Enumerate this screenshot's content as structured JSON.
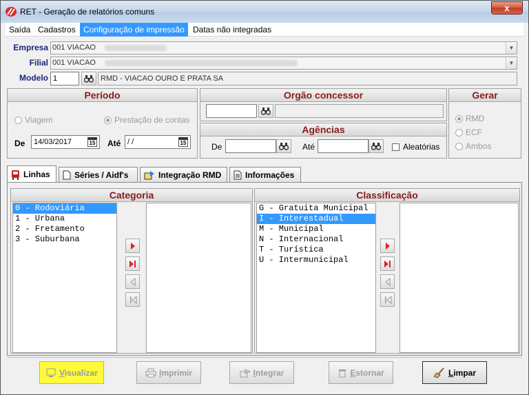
{
  "window": {
    "title": "RET - Geração de relatórios comuns",
    "close_label": "x"
  },
  "menu": [
    {
      "label": "Saída"
    },
    {
      "label": "Cadastros"
    },
    {
      "label": "Configuração de impressão"
    },
    {
      "label": "Datas não integradas"
    }
  ],
  "form": {
    "empresa_label": "Empresa",
    "empresa_value": "001 VIACAO",
    "filial_label": "Filial",
    "filial_value": "001 VIACAO",
    "modelo_label": "Modelo",
    "modelo_code": "1",
    "modelo_desc": "RMD - VIACAO OURO E PRATA SA"
  },
  "periodo": {
    "title": "Período",
    "radio_viagem": "Viagem",
    "radio_prestacao": "Prestação de contas",
    "de_label": "De",
    "de_value": "14/03/2017",
    "ate_label": "Até",
    "ate_value": " / /",
    "cal_label": "15"
  },
  "orgao": {
    "title": "Orgão concessor"
  },
  "agencias": {
    "title": "Agências",
    "de_label": "De",
    "ate_label": "Até",
    "aleatorias_label": "Aleatórias"
  },
  "gerar": {
    "title": "Gerar",
    "options": [
      {
        "label": "RMD"
      },
      {
        "label": "ECF"
      },
      {
        "label": "Ambos"
      }
    ]
  },
  "tabs": [
    {
      "label": "Linhas"
    },
    {
      "label": "Séries / Aidf's"
    },
    {
      "label": "Integração RMD"
    },
    {
      "label": "Informações"
    }
  ],
  "categoria": {
    "title": "Categoria",
    "items": [
      "0 - Rodoviária",
      "1 - Urbana",
      "2 - Fretamento",
      "3 - Suburbana"
    ]
  },
  "classificacao": {
    "title": "Classificação",
    "items": [
      "G - Gratuita Municipal",
      "I - Interestadual",
      "M - Municipal",
      "N - Internacional",
      "T - Turística",
      "U - Intermunicipal"
    ]
  },
  "actions": {
    "visualizar_pre": "V",
    "visualizar_post": "isualizar",
    "imprimir_pre": "I",
    "imprimir_post": "mprimir",
    "integrar_pre": "I",
    "integrar_post": "ntegrar",
    "estornar_pre": "E",
    "estornar_post": "stornar",
    "limpar_pre": "L",
    "limpar_post": "impar"
  },
  "colors": {
    "accent": "#3399ff",
    "panel_title": "#8b1a1a",
    "label": "#1a237e",
    "highlight": "#fffb3a"
  }
}
